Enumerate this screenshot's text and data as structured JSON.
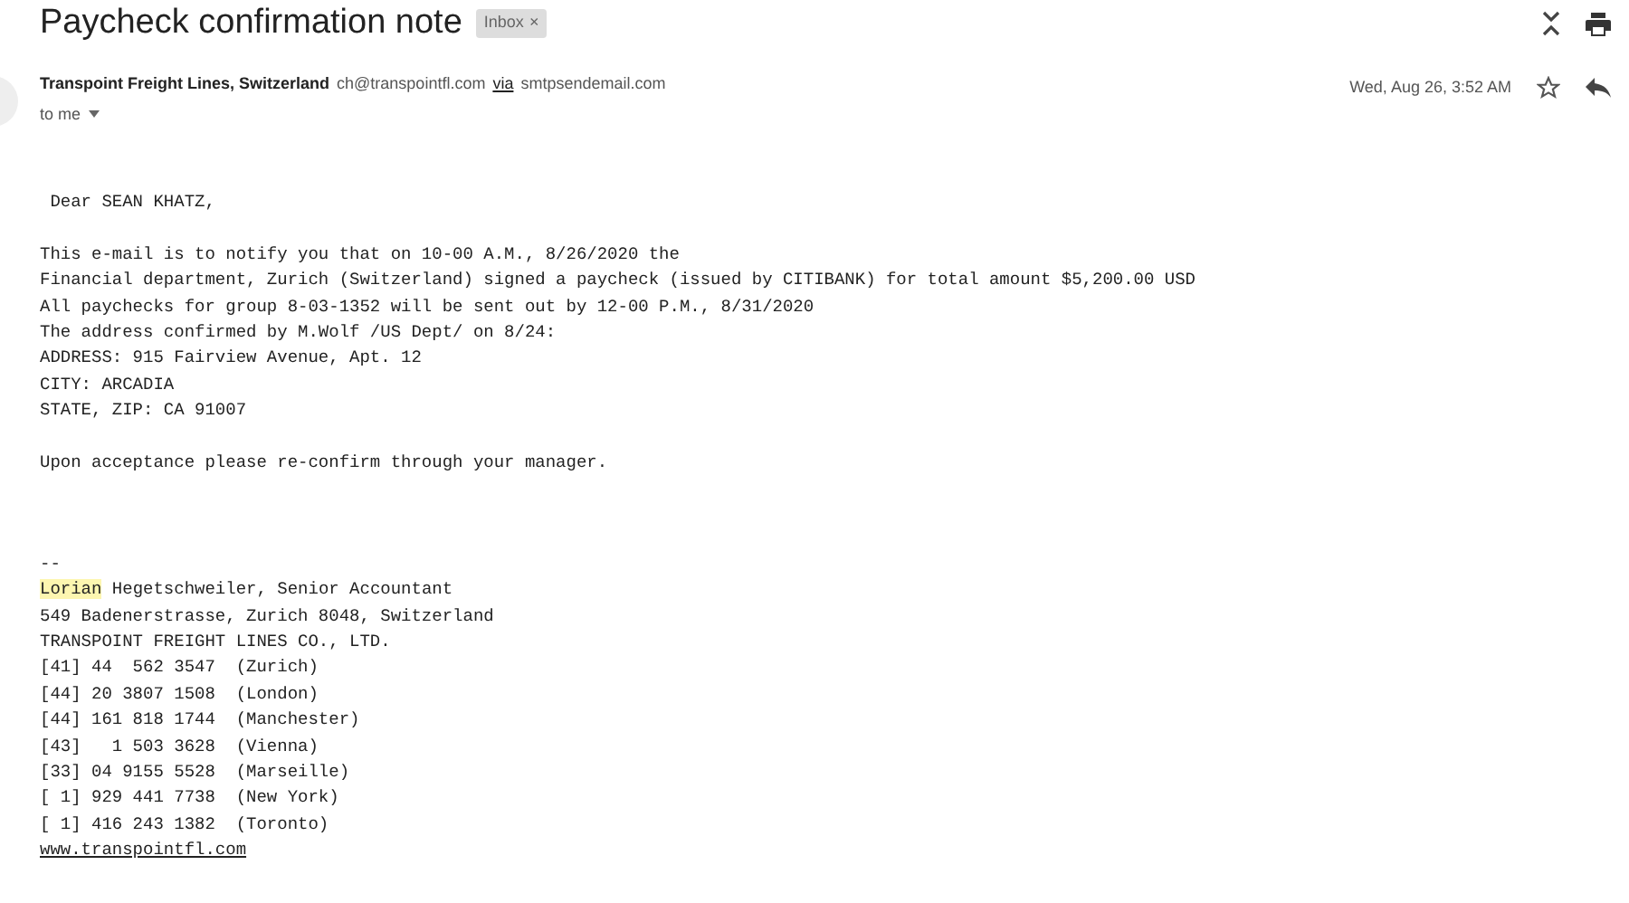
{
  "subject": "Paycheck confirmation note",
  "label": {
    "text": "Inbox",
    "close": "×"
  },
  "sender": {
    "name": "Transpoint Freight Lines, Switzerland",
    "email": "ch@transpointfl.com",
    "via": "via",
    "relay": "smtpsendemail.com"
  },
  "recipient": "to me",
  "date": "Wed, Aug 26, 3:52 AM",
  "starred": false,
  "body": [
    [
      " Dear SEAN KHATZ,"
    ],
    [
      "This e-mail is to notify you that on 10-00 A.M., 8/26/2020 the",
      "Financial department, Zurich (Switzerland) signed a paycheck (issued by CITIBANK) for total amount $5,200.00 USD",
      "All paychecks for group 8-03-1352 will be sent out by 12-00 P.M., 8/31/2020",
      "The address confirmed by M.Wolf /US Dept/ on 8/24:",
      "ADDRESS: 915 Fairview Avenue, Apt. 12",
      "CITY: ARCADIA",
      "STATE, ZIP: CA 91007"
    ],
    [
      "Upon acceptance please re-confirm through your manager."
    ]
  ],
  "signature": {
    "separator": "--",
    "highlighted": "Lorian",
    "name_rest": " Hegetschweiler, Senior Accountant",
    "lines": [
      "549 Badenerstrasse, Zurich 8048, Switzerland",
      "TRANSPOINT FREIGHT LINES CO., LTD.",
      "[41] 44  562 3547  (Zurich)",
      "[44] 20 3807 1508  (London)",
      "[44] 161 818 1744  (Manchester)",
      "[43]   1 503 3628  (Vienna)",
      "[33] 04 9155 5528  (Marseille)",
      "[ 1] 929 441 7738  (New York)",
      "[ 1] 416 243 1382  (Toronto)"
    ],
    "link": "www.transpointfl.com"
  }
}
